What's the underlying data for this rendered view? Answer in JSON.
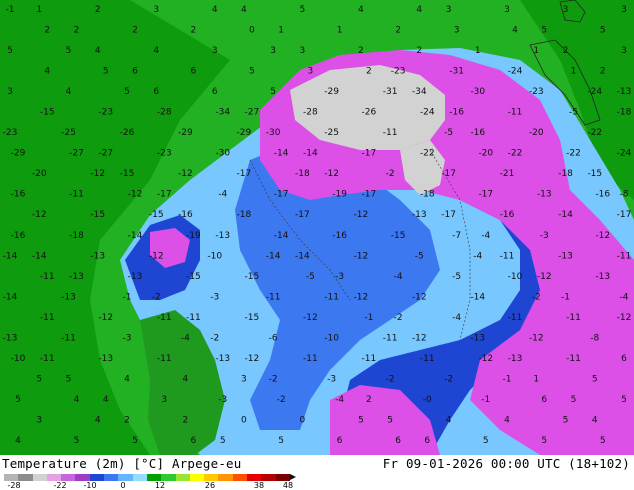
{
  "map": {
    "header": "Temperature (2m) [°C] Arpege-eu",
    "timestamp": "Fr 09-01-2026 00:00 UTC (18+102)",
    "colorbar_ticks": [
      "-28",
      "-22",
      "-10",
      "0",
      "12",
      "26",
      "38",
      "48"
    ],
    "colorbar_colors": [
      "#b4b4b4",
      "#8c8c8c",
      "#d2d2d2",
      "#e6a0e6",
      "#c864dc",
      "#a03cc8",
      "#1e46d2",
      "#3c78f0",
      "#64b4ff",
      "#96dcff",
      "#00a000",
      "#32c832",
      "#96e632",
      "#ffff00",
      "#ffc800",
      "#ff9600",
      "#ff5000",
      "#e60000",
      "#b40000",
      "#780000"
    ],
    "colors": {
      "sea_far": "#0e9b0e",
      "sea_near": "#22b122",
      "land_mild": "#1f9a1f",
      "cold_light": "#78c8ff",
      "cold_mid": "#3c78f0",
      "cold_deep": "#1e46d2",
      "very_cold": "#dc50e8",
      "extreme_cold": "#c864dc",
      "arctic": "#d2d2d2"
    },
    "labels": [
      {
        "t": "-1"
      },
      {
        "t": "1"
      },
      {
        "t": "2"
      },
      {
        "t": "3"
      },
      {
        "t": "4"
      },
      {
        "t": "4"
      },
      {
        "t": "5"
      },
      {
        "t": "4"
      },
      {
        "t": "4"
      },
      {
        "t": "3"
      },
      {
        "t": "3"
      },
      {
        "t": "3"
      },
      {
        "t": "3"
      },
      {
        "t": "2"
      },
      {
        "t": "2"
      },
      {
        "t": "2"
      },
      {
        "t": "2"
      },
      {
        "t": "0"
      },
      {
        "t": "1"
      },
      {
        "t": "1"
      },
      {
        "t": "2"
      },
      {
        "t": "3"
      },
      {
        "t": "4"
      },
      {
        "t": "5"
      },
      {
        "t": "5"
      },
      {
        "t": "5"
      },
      {
        "t": "5"
      },
      {
        "t": "4"
      },
      {
        "t": "4"
      },
      {
        "t": "3"
      },
      {
        "t": "3"
      },
      {
        "t": "3"
      },
      {
        "t": "2"
      },
      {
        "t": "2"
      },
      {
        "t": "1"
      },
      {
        "t": "1"
      },
      {
        "t": "2"
      },
      {
        "t": "3"
      },
      {
        "t": "4"
      },
      {
        "t": "5"
      },
      {
        "t": "6"
      },
      {
        "t": "6"
      },
      {
        "t": "5"
      },
      {
        "t": "3"
      },
      {
        "t": "2"
      },
      {
        "t": "-23"
      },
      {
        "t": "-31"
      },
      {
        "t": "-24"
      },
      {
        "t": "1"
      },
      {
        "t": "2"
      },
      {
        "t": "3"
      },
      {
        "t": "4"
      },
      {
        "t": "5"
      },
      {
        "t": "6"
      },
      {
        "t": "6"
      },
      {
        "t": "5"
      },
      {
        "t": "-29"
      },
      {
        "t": "-31"
      },
      {
        "t": "-34"
      },
      {
        "t": "-30"
      },
      {
        "t": "-23"
      },
      {
        "t": "-24"
      },
      {
        "t": "-13"
      },
      {
        "t": "-15"
      },
      {
        "t": "-23"
      },
      {
        "t": "-28"
      },
      {
        "t": "-34"
      },
      {
        "t": "-27"
      },
      {
        "t": "-28"
      },
      {
        "t": "-26"
      },
      {
        "t": "-24"
      },
      {
        "t": "-16"
      },
      {
        "t": "-11"
      },
      {
        "t": "-5"
      },
      {
        "t": "-18"
      },
      {
        "t": "-23"
      },
      {
        "t": "-25"
      },
      {
        "t": "-26"
      },
      {
        "t": "-29"
      },
      {
        "t": "-29"
      },
      {
        "t": "-30"
      },
      {
        "t": "-25"
      },
      {
        "t": "-11"
      },
      {
        "t": "-5"
      },
      {
        "t": "-16"
      },
      {
        "t": "-20"
      },
      {
        "t": "-22"
      },
      {
        "t": "-29"
      },
      {
        "t": "-27"
      },
      {
        "t": "-27"
      },
      {
        "t": "-23"
      },
      {
        "t": "-30"
      },
      {
        "t": "-14"
      },
      {
        "t": "-14"
      },
      {
        "t": "-17"
      },
      {
        "t": "-22"
      },
      {
        "t": "-20"
      },
      {
        "t": "-22"
      },
      {
        "t": "-22"
      },
      {
        "t": "-24"
      },
      {
        "t": "-20"
      },
      {
        "t": "-12"
      },
      {
        "t": "-15"
      },
      {
        "t": "-12"
      },
      {
        "t": "-17"
      },
      {
        "t": "-18"
      },
      {
        "t": "-12"
      },
      {
        "t": "-2"
      },
      {
        "t": "-17"
      },
      {
        "t": "-21"
      },
      {
        "t": "-18"
      },
      {
        "t": "-15"
      },
      {
        "t": "-16"
      },
      {
        "t": "-11"
      },
      {
        "t": "-12"
      },
      {
        "t": "-17"
      },
      {
        "t": "-4"
      },
      {
        "t": "-17"
      },
      {
        "t": "-19"
      },
      {
        "t": "-17"
      },
      {
        "t": "-18"
      },
      {
        "t": "-17"
      },
      {
        "t": "-13"
      },
      {
        "t": "-16"
      },
      {
        "t": "-8"
      },
      {
        "t": "-12"
      },
      {
        "t": "-15"
      },
      {
        "t": "-15"
      },
      {
        "t": "-16"
      },
      {
        "t": "-18"
      },
      {
        "t": "-17"
      },
      {
        "t": "-12"
      },
      {
        "t": "-13"
      },
      {
        "t": "-17"
      },
      {
        "t": "-16"
      },
      {
        "t": "-14"
      },
      {
        "t": "-17"
      },
      {
        "t": "-16"
      },
      {
        "t": "-18"
      },
      {
        "t": "-14"
      },
      {
        "t": "-19"
      },
      {
        "t": "-13"
      },
      {
        "t": "-14"
      },
      {
        "t": "-16"
      },
      {
        "t": "-15"
      },
      {
        "t": "-7"
      },
      {
        "t": "-4"
      },
      {
        "t": "-3"
      },
      {
        "t": "-12"
      },
      {
        "t": "-14"
      },
      {
        "t": "-14"
      },
      {
        "t": "-13"
      },
      {
        "t": "-12"
      },
      {
        "t": "-10"
      },
      {
        "t": "-14"
      },
      {
        "t": "-14"
      },
      {
        "t": "-12"
      },
      {
        "t": "-5"
      },
      {
        "t": "-4"
      },
      {
        "t": "-11"
      },
      {
        "t": "-13"
      },
      {
        "t": "-11"
      },
      {
        "t": "-11"
      },
      {
        "t": "-13"
      },
      {
        "t": "-13"
      },
      {
        "t": "-15"
      },
      {
        "t": "-15"
      },
      {
        "t": "-5"
      },
      {
        "t": "-3"
      },
      {
        "t": "-4"
      },
      {
        "t": "-5"
      },
      {
        "t": "-10"
      },
      {
        "t": "-12"
      },
      {
        "t": "-13"
      },
      {
        "t": "-14"
      },
      {
        "t": "-13"
      },
      {
        "t": "-1"
      },
      {
        "t": "-2"
      },
      {
        "t": "-3"
      },
      {
        "t": "-11"
      },
      {
        "t": "-11"
      },
      {
        "t": "-12"
      },
      {
        "t": "-12"
      },
      {
        "t": "-14"
      },
      {
        "t": "-2"
      },
      {
        "t": "-1"
      },
      {
        "t": "-4"
      },
      {
        "t": "-11"
      },
      {
        "t": "-12"
      },
      {
        "t": "-11"
      },
      {
        "t": "-11"
      },
      {
        "t": "-15"
      },
      {
        "t": "-12"
      },
      {
        "t": "-1"
      },
      {
        "t": "-2"
      },
      {
        "t": "-4"
      },
      {
        "t": "-11"
      },
      {
        "t": "-11"
      },
      {
        "t": "-12"
      },
      {
        "t": "-13"
      },
      {
        "t": "-11"
      },
      {
        "t": "-3"
      },
      {
        "t": "-4"
      },
      {
        "t": "-2"
      },
      {
        "t": "-6"
      },
      {
        "t": "-10"
      },
      {
        "t": "-11"
      },
      {
        "t": "-12"
      },
      {
        "t": "-13"
      },
      {
        "t": "-12"
      },
      {
        "t": "-8"
      },
      {
        "t": "-10"
      },
      {
        "t": "-11"
      },
      {
        "t": "-13"
      },
      {
        "t": "-11"
      },
      {
        "t": "-13"
      },
      {
        "t": "-12"
      },
      {
        "t": "-11"
      },
      {
        "t": "-11"
      },
      {
        "t": "-11"
      },
      {
        "t": "-12"
      },
      {
        "t": "-13"
      },
      {
        "t": "-11"
      },
      {
        "t": "6"
      },
      {
        "t": "5"
      },
      {
        "t": "5"
      },
      {
        "t": "4"
      },
      {
        "t": "4"
      },
      {
        "t": "3"
      },
      {
        "t": "-2"
      },
      {
        "t": "-3"
      },
      {
        "t": "-2"
      },
      {
        "t": "-2"
      },
      {
        "t": "-1"
      },
      {
        "t": "1"
      },
      {
        "t": "5"
      },
      {
        "t": "5"
      },
      {
        "t": "4"
      },
      {
        "t": "4"
      },
      {
        "t": "3"
      },
      {
        "t": "-3"
      },
      {
        "t": "-2"
      },
      {
        "t": "-4"
      },
      {
        "t": "2"
      },
      {
        "t": "-0"
      },
      {
        "t": "-1"
      },
      {
        "t": "6"
      },
      {
        "t": "5"
      },
      {
        "t": "5"
      },
      {
        "t": "3"
      },
      {
        "t": "4"
      },
      {
        "t": "2"
      },
      {
        "t": "2"
      },
      {
        "t": "0"
      },
      {
        "t": "0"
      },
      {
        "t": "5"
      },
      {
        "t": "5"
      },
      {
        "t": "4"
      },
      {
        "t": "4"
      },
      {
        "t": "5"
      },
      {
        "t": "4"
      },
      {
        "t": "4"
      },
      {
        "t": "5"
      },
      {
        "t": "5"
      },
      {
        "t": "6"
      },
      {
        "t": "5"
      },
      {
        "t": "5"
      },
      {
        "t": "6"
      },
      {
        "t": "6"
      },
      {
        "t": "6"
      },
      {
        "t": "5"
      },
      {
        "t": "5"
      },
      {
        "t": "5"
      }
    ]
  }
}
